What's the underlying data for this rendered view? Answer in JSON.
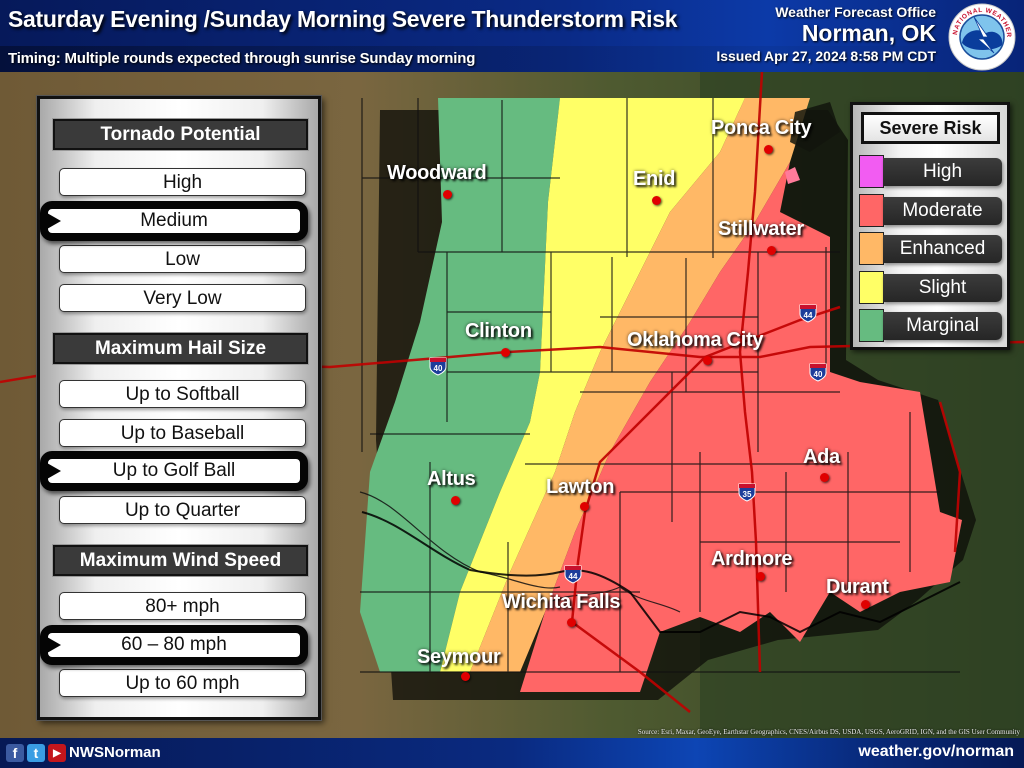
{
  "header": {
    "title": "Saturday Evening /Sunday Morning Severe Thunderstorm Risk",
    "subtitle": "Timing: Multiple rounds expected through sunrise Sunday morning",
    "office_label": "Weather Forecast Office",
    "office_name": "Norman, OK",
    "issued": "Issued Apr 27, 2024 8:58 PM CDT",
    "logo_icon": "nws-logo-icon",
    "logo_text": "NATIONAL WEATHER SERVICE"
  },
  "threats": {
    "tornado": {
      "heading": "Tornado Potential",
      "options": [
        "High",
        "Medium",
        "Low",
        "Very Low"
      ],
      "selected": "Medium"
    },
    "hail": {
      "heading": "Maximum Hail Size",
      "options": [
        "Up to Softball",
        "Up to Baseball",
        "Up to Golf Ball",
        "Up to Quarter"
      ],
      "selected": "Up to Golf Ball"
    },
    "wind": {
      "heading": "Maximum Wind Speed",
      "options": [
        "80+ mph",
        "60 – 80 mph",
        "Up to 60 mph"
      ],
      "selected": "60 – 80 mph"
    }
  },
  "legend": {
    "title": "Severe Risk",
    "items": [
      {
        "label": "High",
        "color": "#f25cf2"
      },
      {
        "label": "Moderate",
        "color": "#ff6666"
      },
      {
        "label": "Enhanced",
        "color": "#ffb866"
      },
      {
        "label": "Slight",
        "color": "#ffff66"
      },
      {
        "label": "Marginal",
        "color": "#66bb80"
      }
    ]
  },
  "map": {
    "cities": [
      {
        "name": "Woodward"
      },
      {
        "name": "Enid"
      },
      {
        "name": "Ponca City"
      },
      {
        "name": "Stillwater"
      },
      {
        "name": "Clinton"
      },
      {
        "name": "Oklahoma City"
      },
      {
        "name": "Altus"
      },
      {
        "name": "Lawton"
      },
      {
        "name": "Ada"
      },
      {
        "name": "Ardmore"
      },
      {
        "name": "Durant"
      },
      {
        "name": "Wichita Falls"
      },
      {
        "name": "Seymour"
      }
    ],
    "interstates": [
      "40",
      "40",
      "44",
      "44",
      "35"
    ],
    "attribution": "Source: Esri, Maxar, GeoEye, Earthstar Geographics, CNES/Airbus DS, USDA, USGS, AeroGRID, IGN, and the GIS User Community"
  },
  "footer": {
    "social": [
      "f",
      "t",
      "▶"
    ],
    "handle": "NWSNorman",
    "website": "weather.gov/norman"
  }
}
